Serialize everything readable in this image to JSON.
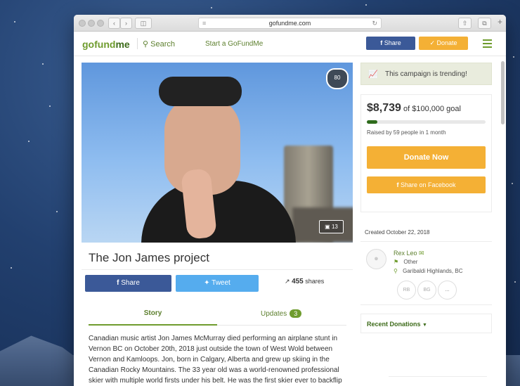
{
  "browser": {
    "url": "gofundme.com"
  },
  "header": {
    "logo_go": "go",
    "logo_fund": "fund",
    "logo_me": "me",
    "search_label": "Search",
    "start_label": "Start a GoFundMe",
    "share_label": "Share",
    "donate_label": "Donate"
  },
  "campaign": {
    "title": "The Jon James project",
    "heart_count": "80",
    "photo_count": "13",
    "share_label": "Share",
    "tweet_label": "Tweet",
    "shares_count": "455",
    "shares_label": "shares",
    "tabs": {
      "story": "Story",
      "updates": "Updates",
      "updates_count": "3"
    },
    "story_text": "Canadian music artist Jon James McMurray died performing an airplane stunt in Vernon BC on October 20th, 2018 just outside the town of West Wold between Vernon and Kamloops. Jon, born in Calgary, Alberta and grew up skiing in the Canadian Rocky Mountains. The 33 year old was a world-renowned professional skier with multiple world firsts under his belt. He was the first skier ever to backflip"
  },
  "sidebar": {
    "trending_text": "This campaign is trending!",
    "raised_amount": "$8,739",
    "goal_text": "of $100,000 goal",
    "progress_fraction": 0.087,
    "raised_sub": "Raised by 59 people in 1 month",
    "donate_now": "Donate Now",
    "share_facebook": "Share on Facebook",
    "created": "Created October 22, 2018",
    "organizer_name": "Rex Leo",
    "organizer_category": "Other",
    "organizer_location": "Garibaldi Highlands, BC",
    "donor_initials": [
      "RB",
      "BG",
      "..."
    ],
    "recent_donations": "Recent Donations"
  },
  "colors": {
    "brand_green": "#6f9c2e",
    "facebook_blue": "#3b5998",
    "twitter_blue": "#55acee",
    "donate_orange": "#f4b035"
  }
}
